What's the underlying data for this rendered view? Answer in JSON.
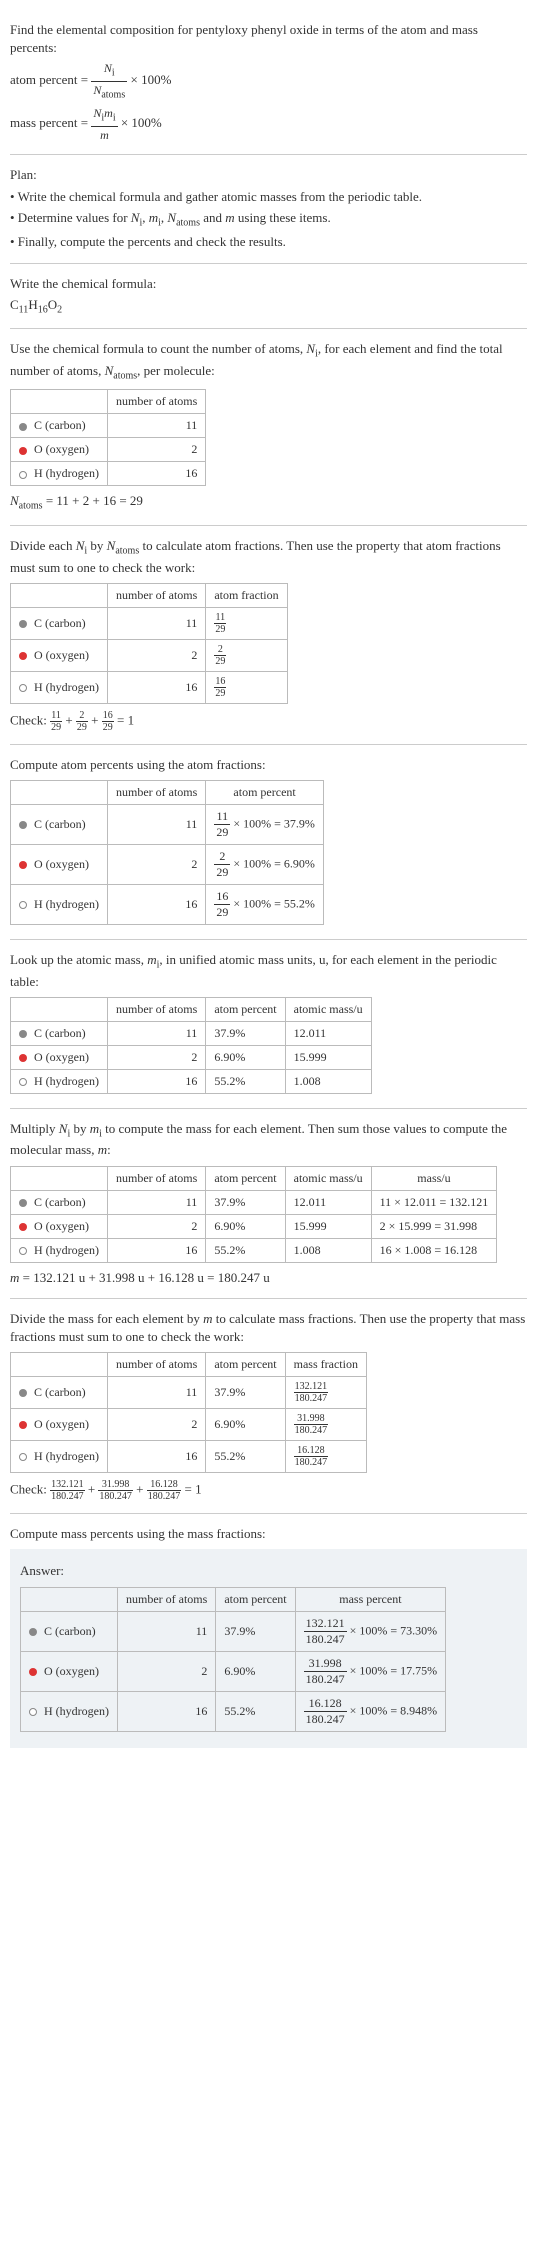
{
  "intro": {
    "line1": "Find the elemental composition for pentyloxy phenyl oxide in terms of the atom and mass percents:",
    "atom_percent_lhs": "atom percent = ",
    "atom_percent_frac_num": "N",
    "atom_percent_frac_num_sub": "i",
    "atom_percent_frac_den": "N",
    "atom_percent_frac_den_sub": "atoms",
    "times100": " × 100%",
    "mass_percent_lhs": "mass percent = ",
    "mass_percent_frac_num": "N",
    "mass_percent_frac_num_sub": "i",
    "mass_percent_frac_num2": "m",
    "mass_percent_frac_num2_sub": "i",
    "mass_percent_frac_den": "m"
  },
  "plan": {
    "heading": "Plan:",
    "bullet1": "• Write the chemical formula and gather atomic masses from the periodic table.",
    "bullet2_pre": "• Determine values for ",
    "bullet2_items": "N_i, m_i, N_atoms and m",
    "bullet2_post": " using these items.",
    "bullet3": "• Finally, compute the percents and check the results."
  },
  "chem_formula": {
    "heading": "Write the chemical formula:",
    "formula": "C",
    "c_sub": "11",
    "h": "H",
    "h_sub": "16",
    "o": "O",
    "o_sub": "2"
  },
  "count_atoms": {
    "text1": "Use the chemical formula to count the number of atoms, ",
    "ni": "N",
    "ni_sub": "i",
    "text2": ", for each element and find the total number of atoms, ",
    "natoms": "N",
    "natoms_sub": "atoms",
    "text3": ", per molecule:",
    "header_empty": "",
    "header_num": "number of atoms",
    "row_c_label": " C (carbon)",
    "row_c_val": "11",
    "row_o_label": " O (oxygen)",
    "row_o_val": "2",
    "row_h_label": " H (hydrogen)",
    "row_h_val": "16",
    "sum_lhs": "N",
    "sum_lhs_sub": "atoms",
    "sum_eq": " = 11 + 2 + 16 = 29"
  },
  "atom_fractions": {
    "text1": "Divide each ",
    "text2": " by ",
    "text3": " to calculate atom fractions. Then use the property that atom fractions must sum to one to check the work:",
    "header_num": "number of atoms",
    "header_frac": "atom fraction",
    "c_val": "11",
    "c_frac_num": "11",
    "c_frac_den": "29",
    "o_val": "2",
    "o_frac_num": "2",
    "o_frac_den": "29",
    "h_val": "16",
    "h_frac_num": "16",
    "h_frac_den": "29",
    "check_label": "Check: ",
    "check_eq": " = 1"
  },
  "atom_percents": {
    "heading": "Compute atom percents using the atom fractions:",
    "header_num": "number of atoms",
    "header_pct": "atom percent",
    "c_val": "11",
    "c_frac_num": "11",
    "c_frac_den": "29",
    "c_pct": " × 100% = 37.9%",
    "o_val": "2",
    "o_frac_num": "2",
    "o_frac_den": "29",
    "o_pct": " × 100% = 6.90%",
    "h_val": "16",
    "h_frac_num": "16",
    "h_frac_den": "29",
    "h_pct": " × 100% = 55.2%"
  },
  "atomic_mass": {
    "text1": "Look up the atomic mass, ",
    "mi": "m",
    "mi_sub": "i",
    "text2": ", in unified atomic mass units, u, for each element in the periodic table:",
    "header_num": "number of atoms",
    "header_pct": "atom percent",
    "header_mass": "atomic mass/u",
    "c_num": "11",
    "c_pct": "37.9%",
    "c_mass": "12.011",
    "o_num": "2",
    "o_pct": "6.90%",
    "o_mass": "15.999",
    "h_num": "16",
    "h_pct": "55.2%",
    "h_mass": "1.008"
  },
  "multiply": {
    "text1": "Multiply ",
    "text2": " by ",
    "text3": " to compute the mass for each element. Then sum those values to compute the molecular mass, ",
    "m": "m",
    "text4": ":",
    "header_num": "number of atoms",
    "header_pct": "atom percent",
    "header_mass": "atomic mass/u",
    "header_massu": "mass/u",
    "c_num": "11",
    "c_pct": "37.9%",
    "c_mass": "12.011",
    "c_calc": "11 × 12.011 = 132.121",
    "o_num": "2",
    "o_pct": "6.90%",
    "o_mass": "15.999",
    "o_calc": "2 × 15.999 = 31.998",
    "h_num": "16",
    "h_pct": "55.2%",
    "h_mass": "1.008",
    "h_calc": "16 × 1.008 = 16.128",
    "sum": "m = 132.121 u + 31.998 u + 16.128 u = 180.247 u"
  },
  "mass_fractions": {
    "text": "Divide the mass for each element by m to calculate mass fractions. Then use the property that mass fractions must sum to one to check the work:",
    "header_num": "number of atoms",
    "header_pct": "atom percent",
    "header_mfrac": "mass fraction",
    "c_num": "11",
    "c_pct": "37.9%",
    "c_mfrac_num": "132.121",
    "c_mfrac_den": "180.247",
    "o_num": "2",
    "o_pct": "6.90%",
    "o_mfrac_num": "31.998",
    "o_mfrac_den": "180.247",
    "h_num": "16",
    "h_pct": "55.2%",
    "h_mfrac_num": "16.128",
    "h_mfrac_den": "180.247",
    "check_label": "Check: ",
    "check_eq": " = 1"
  },
  "mass_percents": {
    "heading": "Compute mass percents using the mass fractions:",
    "answer_label": "Answer:",
    "header_num": "number of atoms",
    "header_pct": "atom percent",
    "header_mpct": "mass percent",
    "c_num": "11",
    "c_pct": "37.9%",
    "c_frac_num": "132.121",
    "c_frac_den": "180.247",
    "c_result": " × 100% = 73.30%",
    "o_num": "2",
    "o_pct": "6.90%",
    "o_frac_num": "31.998",
    "o_frac_den": "180.247",
    "o_result": " × 100% = 17.75%",
    "h_num": "16",
    "h_pct": "55.2%",
    "h_frac_num": "16.128",
    "h_frac_den": "180.247",
    "h_result": " × 100% = 8.948%"
  },
  "labels": {
    "c": " C (carbon)",
    "o": " O (oxygen)",
    "h": " H (hydrogen)"
  }
}
